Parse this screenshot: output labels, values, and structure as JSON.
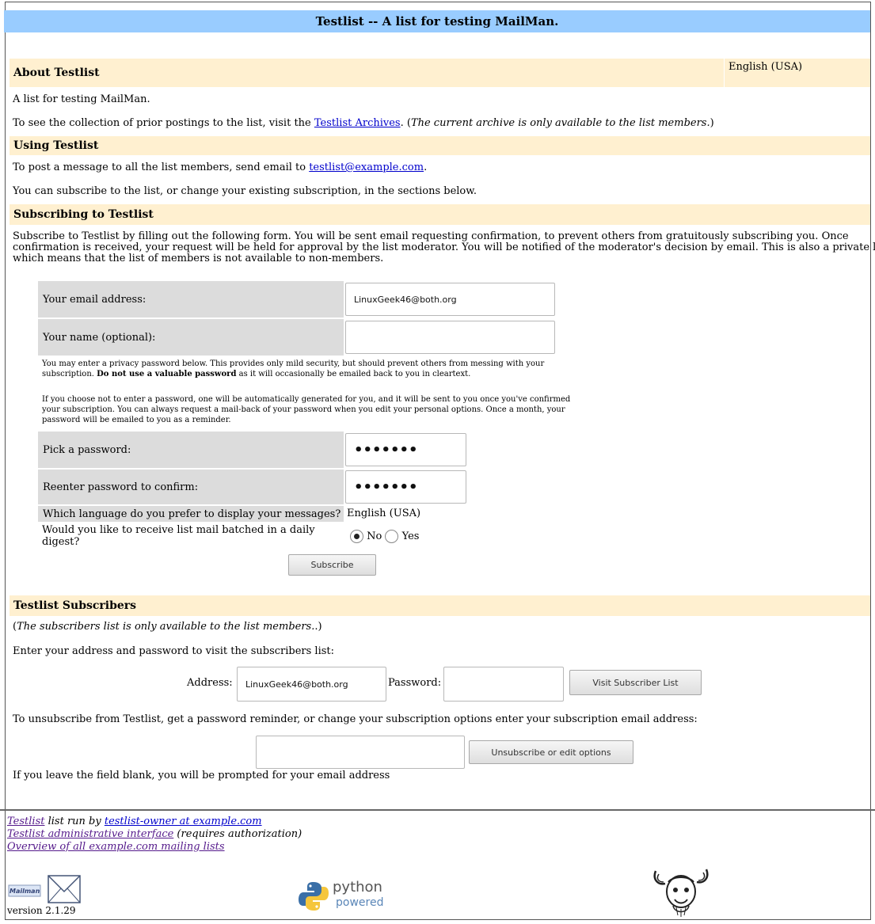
{
  "page": {
    "title": "Testlist -- A list for testing MailMan.",
    "language": "English (USA)"
  },
  "about": {
    "heading": "About Testlist",
    "description": "A list for testing MailMan.",
    "archives_pre": "To see the collection of prior postings to the list, visit the ",
    "archives_link": "Testlist Archives",
    "archives_post_dot": ". (",
    "archives_note": "The current archive is only available to the list members.",
    "archives_close": ")"
  },
  "using": {
    "heading": "Using Testlist",
    "post_pre": "To post a message to all the list members, send email to ",
    "post_email": "testlist@example.com",
    "post_end": ".",
    "subscribe_text": "You can subscribe to the list, or change your existing subscription, in the sections below."
  },
  "subscribing": {
    "heading": "Subscribing to Testlist",
    "intro_1": "Subscribe to Testlist by filling out the following form. You will be sent email requesting confirmation, to prevent others from gratuitously subscribing you. Once",
    "intro_2": "confirmation is received, your request will be held for approval by the list moderator. You will be notified of the moderator's decision by email. This is also a private list,",
    "intro_3": "which means that the list of members is not available to non-members.",
    "email_label": "Your email address:",
    "email_value": "LinuxGeek46@both.org",
    "name_label": "Your name (optional):",
    "name_value": "",
    "pw_note_1": "You may enter a privacy password below. This provides only mild security, but should prevent others from messing with your",
    "pw_note_2a": "subscription. ",
    "pw_note_2b": "Do not use a valuable password",
    "pw_note_2c": " as it will occasionally be emailed back to you in cleartext.",
    "pw_note_3": "If you choose not to enter a password, one will be automatically generated for you, and it will be sent to you once you've confirmed",
    "pw_note_4": "your subscription. You can always request a mail-back of your password when you edit your personal options. Once a month, your",
    "pw_note_5": "password will be emailed to you as a reminder.",
    "pick_pw_label": "Pick a password:",
    "pick_pw_value": "•••••••",
    "reenter_pw_label": "Reenter password to confirm:",
    "reenter_pw_value": "•••••••",
    "lang_label": "Which language do you prefer to display your messages?",
    "lang_value": "English (USA)",
    "digest_label_1": "Would you like to receive list mail batched in a daily",
    "digest_label_2": "digest?",
    "digest_no": "No",
    "digest_yes": "Yes",
    "digest_selected": "No",
    "subscribe_button": "Subscribe"
  },
  "subscribers": {
    "heading": "Testlist Subscribers",
    "note": "The subscribers list is only available to the list members.",
    "note_open": "(",
    "note_close": ".)",
    "enter_text": "Enter your address and password to visit the subscribers list:",
    "address_label": "Address:",
    "address_value": "LinuxGeek46@both.org",
    "password_label": "Password:",
    "password_value": "",
    "visit_button": "Visit Subscriber List",
    "unsub_text": "To unsubscribe from Testlist, get a password reminder, or change your subscription options enter your subscription email address:",
    "unsub_value": "",
    "unsub_button": "Unsubscribe or edit options",
    "blank_note": "If you leave the field blank, you will be prompted for your email address"
  },
  "footer": {
    "line1_link": "Testlist",
    "line1_mid": " list run by ",
    "line1_owner": "testlist-owner at example.com",
    "line2_link": "Testlist administrative interface",
    "line2_rest": " (requires authorization)",
    "line3_link": "Overview of all example.com mailing lists",
    "mailman_logo_text": "Mailman",
    "version": "version 2.1.29",
    "python_top": "python",
    "python_bottom": "powered"
  }
}
